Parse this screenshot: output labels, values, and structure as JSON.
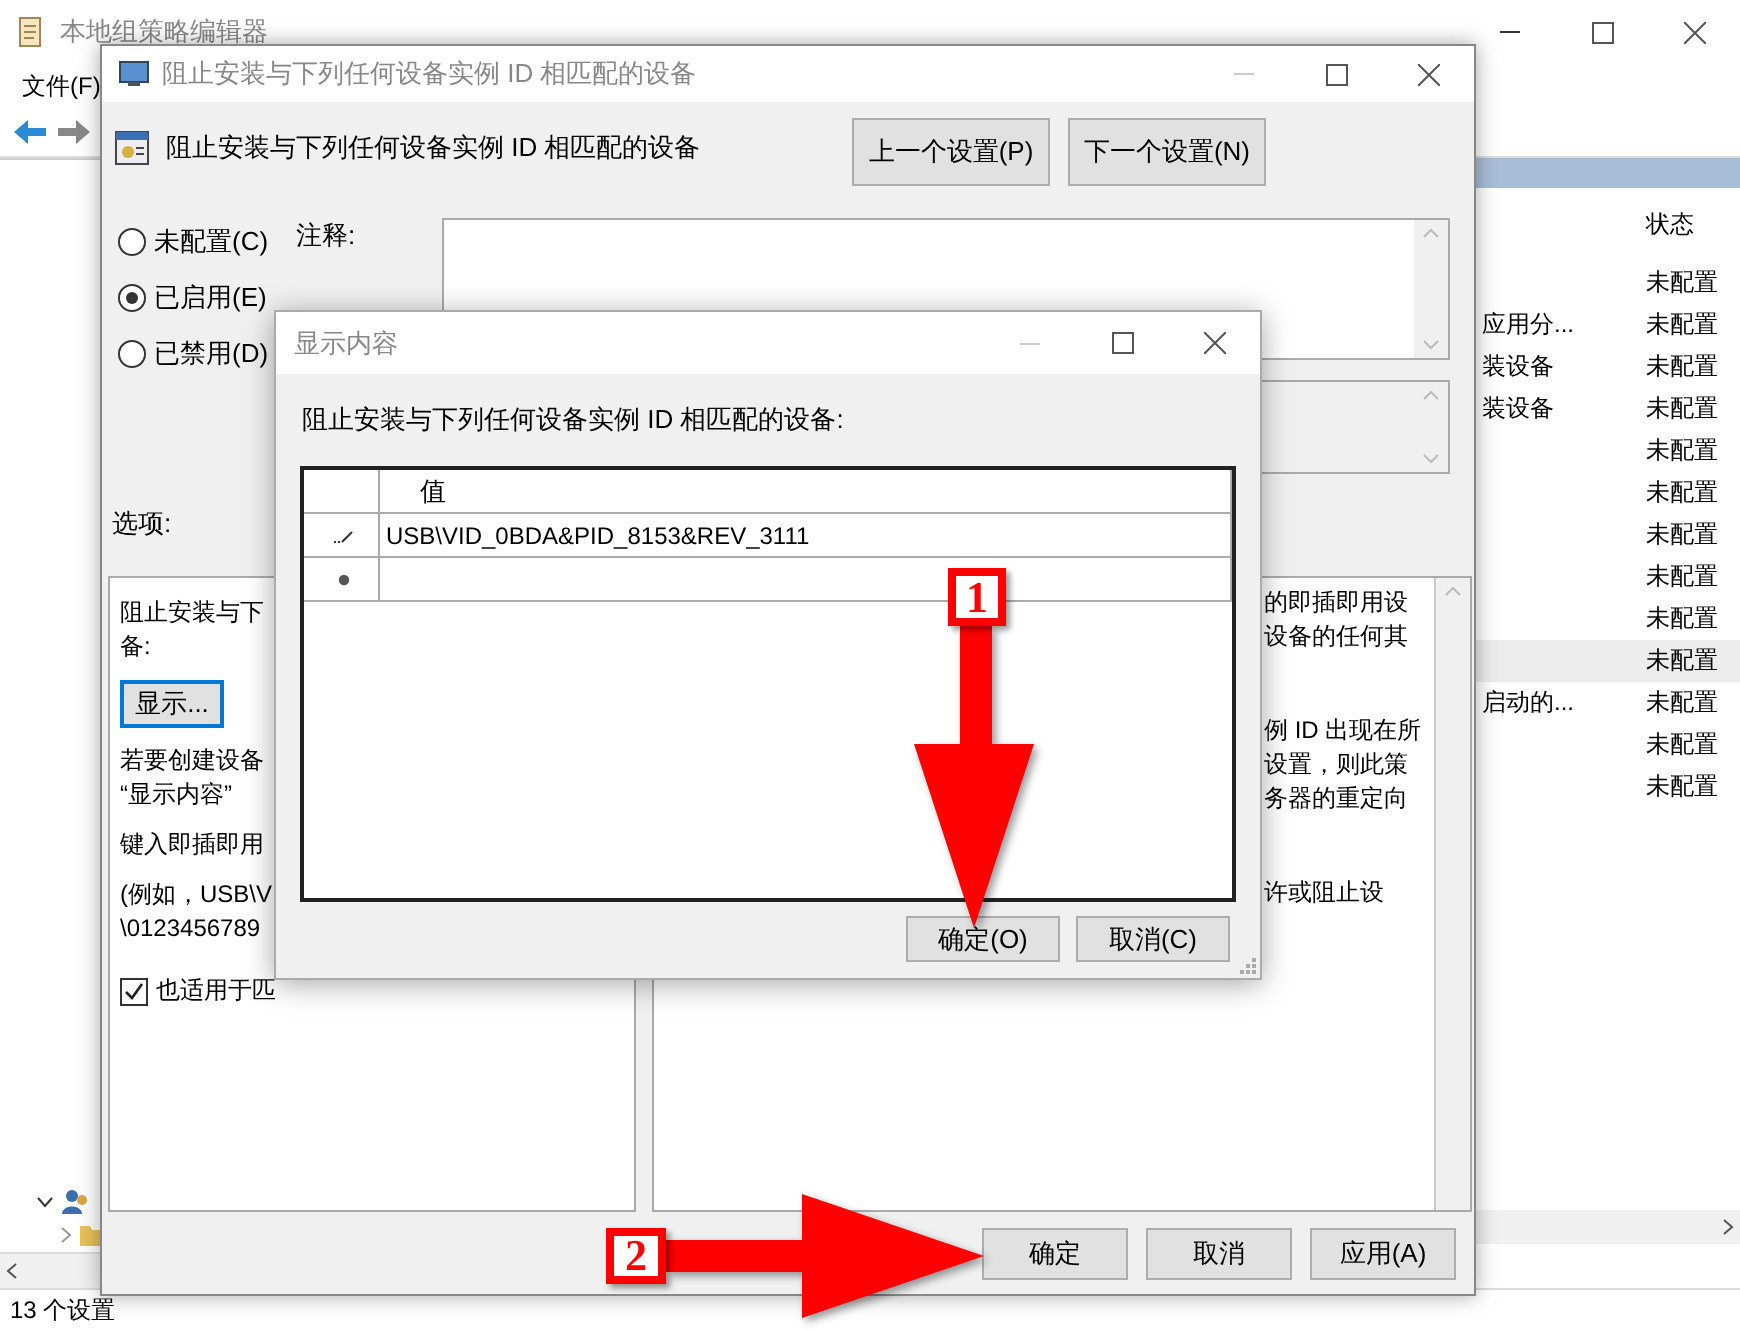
{
  "main_window": {
    "title": "本地组策略编辑器",
    "menu": [
      "文件(F)"
    ],
    "list": {
      "columns": [
        {
          "label": "状态"
        }
      ],
      "rows": [
        {
          "status": "未配置",
          "selected": false
        },
        {
          "name": "应用分...",
          "status": "未配置",
          "selected": false
        },
        {
          "name": "装设备",
          "status": "未配置",
          "selected": false
        },
        {
          "name": "装设备",
          "status": "未配置",
          "selected": false
        },
        {
          "status": "未配置",
          "selected": false
        },
        {
          "status": "未配置",
          "selected": false
        },
        {
          "status": "未配置",
          "selected": false
        },
        {
          "status": "未配置",
          "selected": false
        },
        {
          "status": "未配置",
          "selected": false
        },
        {
          "status": "未配置",
          "selected": true
        },
        {
          "name": "启动的...",
          "status": "未配置",
          "selected": false
        },
        {
          "status": "未配置",
          "selected": false
        },
        {
          "status": "未配置",
          "selected": false
        }
      ]
    },
    "status_bar": "13 个设置"
  },
  "policy_dialog": {
    "title": "阻止安装与下列任何设备实例 ID 相匹配的设备",
    "heading": "阻止安装与下列任何设备实例 ID 相匹配的设备",
    "nav_buttons": [
      "上一个设置(P)",
      "下一个设置(N)"
    ],
    "states": [
      {
        "label": "未配置(C)",
        "selected": false
      },
      {
        "label": "已启用(E)",
        "selected": true
      },
      {
        "label": "已禁用(D)",
        "selected": false
      }
    ],
    "comment_label": "注释:",
    "options_label": "选项:",
    "options": [
      {
        "kind": "text",
        "lines": [
          "阻止安装与下",
          "备:"
        ]
      },
      {
        "kind": "button",
        "label": "显示..."
      },
      {
        "kind": "text",
        "lines": [
          "若要创建设备",
          "“显示内容”"
        ]
      },
      {
        "kind": "text",
        "lines": [
          "键入即插即用"
        ]
      },
      {
        "kind": "text",
        "lines": [
          "(例如，USB\\V",
          "\\0123456789"
        ]
      },
      {
        "kind": "checkbox",
        "label": "也适用于匹",
        "checked": true
      }
    ],
    "help": [
      [
        "的即插即用设",
        "设备的任何其"
      ],
      [
        "例 ID 出现在所",
        "设置，则此策",
        "务器的重定向"
      ],
      [
        "许或阻止设"
      ]
    ],
    "buttons": [
      "确定",
      "取消",
      "应用(A)"
    ]
  },
  "contents_dialog": {
    "title": "显示内容",
    "prompt": "阻止安装与下列任何设备实例 ID 相匹配的设备:",
    "columns": [
      "值"
    ],
    "rows": [
      {
        "kind": "edit",
        "value": "USB\\VID_0BDA&PID_8153&REV_3111"
      },
      {
        "kind": "new"
      }
    ],
    "buttons": [
      "确定(O)",
      "取消(C)"
    ]
  },
  "annotations": [
    {
      "label": "1"
    },
    {
      "label": "2"
    }
  ]
}
